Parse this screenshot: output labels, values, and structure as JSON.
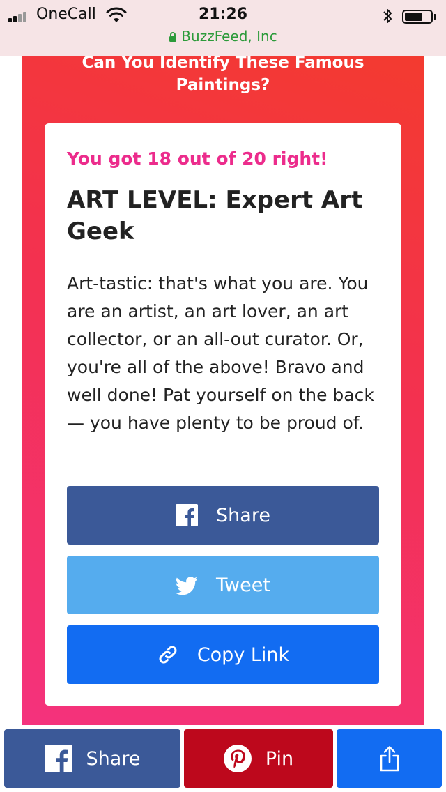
{
  "status_bar": {
    "carrier": "OneCall",
    "time": "21:26",
    "url": "BuzzFeed, Inc",
    "battery_level": 0.7
  },
  "quiz": {
    "title": "Can You Identify These Famous Paintings?"
  },
  "result": {
    "score_text": "You got 18 out of 20 right!",
    "title": "ART LEVEL: Expert Art Geek",
    "description": "Art-tastic: that's what you are. You are an artist, an art lover, an art collector, or an all-out curator. Or, you're all of the above! Bravo and well done! Pat yourself on the back — you have plenty to be proud of."
  },
  "share_buttons": {
    "facebook_label": "Share",
    "twitter_label": "Tweet",
    "copy_link_label": "Copy Link"
  },
  "bottom_bar": {
    "facebook_label": "Share",
    "pinterest_label": "Pin"
  },
  "colors": {
    "facebook": "#3b5998",
    "twitter": "#55acee",
    "copy_link": "#126cf2",
    "pinterest": "#bd081c",
    "score_accent": "#ec2c8c",
    "url_secure": "#2c9a3a"
  },
  "icons": {
    "status": [
      "signal-icon",
      "wifi-icon",
      "bluetooth-icon",
      "battery-icon",
      "lock-icon"
    ],
    "share": [
      "facebook-icon",
      "twitter-icon",
      "link-icon",
      "pinterest-icon",
      "share-icon"
    ]
  }
}
